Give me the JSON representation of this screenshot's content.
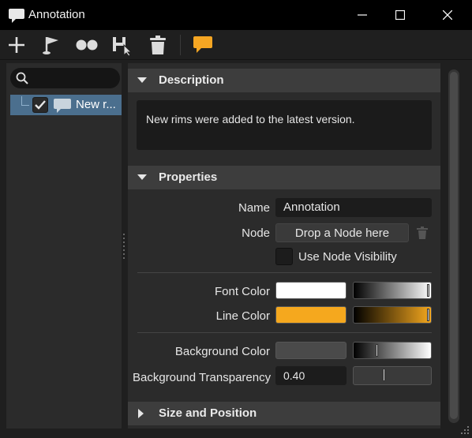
{
  "window": {
    "title": "Annotation"
  },
  "toolbar": {
    "buttons": [
      "add-icon",
      "flag-icon",
      "dots-icon",
      "pick-node-icon",
      "trash-icon",
      "annotation-icon"
    ],
    "accent_color": "#f5a623"
  },
  "tree": {
    "search_placeholder": "",
    "items": [
      {
        "label": "New r...",
        "checked": true
      }
    ]
  },
  "description": {
    "header": "Description",
    "text": "New rims were added to the latest version."
  },
  "properties": {
    "header": "Properties",
    "name_label": "Name",
    "name_value": "Annotation",
    "node_label": "Node",
    "node_button": "Drop a Node here",
    "use_node_visibility_label": "Use Node Visibility",
    "use_node_visibility_checked": false,
    "font_color_label": "Font Color",
    "font_color": "#ffffff",
    "line_color_label": "Line Color",
    "line_color": "#f5a81e",
    "background_color_label": "Background Color",
    "background_color": "#4a4a4a",
    "background_transparency_label": "Background Transparency",
    "background_transparency_value": "0.40"
  },
  "size_position": {
    "header": "Size and Position"
  }
}
